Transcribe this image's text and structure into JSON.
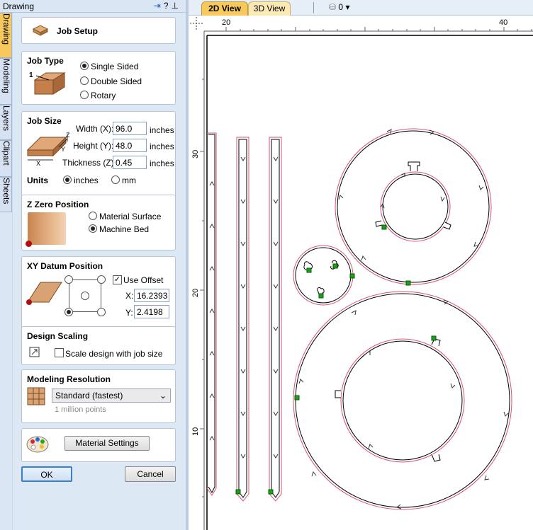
{
  "window": {
    "title": "Drawing"
  },
  "side_tabs": [
    "Drawing",
    "Modeling",
    "Layers",
    "Clipart",
    "Sheets"
  ],
  "job_setup": {
    "title": "Job Setup"
  },
  "job_type": {
    "heading": "Job Type",
    "options": [
      "Single Sided",
      "Double Sided",
      "Rotary"
    ],
    "selected": "Single Sided",
    "icon_label": "1"
  },
  "job_size": {
    "heading": "Job Size",
    "width_label": "Width (X):",
    "width_value": "96.0",
    "height_label": "Height (Y):",
    "height_value": "48.0",
    "thickness_label": "Thickness (Z):",
    "thickness_value": "0.45",
    "unit_text": "inches",
    "units_label": "Units",
    "unit_options": [
      "inches",
      "mm"
    ],
    "selected_unit": "inches",
    "axis_labels": {
      "x": "X",
      "y": "Y",
      "z": "Z"
    }
  },
  "z_zero": {
    "heading": "Z Zero Position",
    "options": [
      "Material Surface",
      "Machine Bed"
    ],
    "selected": "Machine Bed"
  },
  "xy_datum": {
    "heading": "XY Datum Position",
    "use_offset_label": "Use Offset",
    "use_offset_checked": true,
    "x_label": "X:",
    "x_value": "16.2393",
    "y_label": "Y:",
    "y_value": "2.4198"
  },
  "design_scaling": {
    "heading": "Design Scaling",
    "checkbox_label": "Scale design with job size",
    "checked": false
  },
  "modeling_resolution": {
    "heading": "Modeling Resolution",
    "selected": "Standard (fastest)",
    "hint": "1 million points"
  },
  "material": {
    "button_label": "Material Settings"
  },
  "footer": {
    "ok_label": "OK",
    "cancel_label": "Cancel"
  },
  "view_tabs": {
    "tab_2d": "2D View",
    "tab_3d": "3D View",
    "layer_value": "0"
  },
  "ruler": {
    "h_ticks": [
      "20",
      "40"
    ],
    "v_ticks": [
      "30",
      "20",
      "10"
    ]
  },
  "colors": {
    "active_tab": "#f7c95c",
    "toolpath_red": "#d9536f",
    "node_green": "#1aa31a"
  }
}
